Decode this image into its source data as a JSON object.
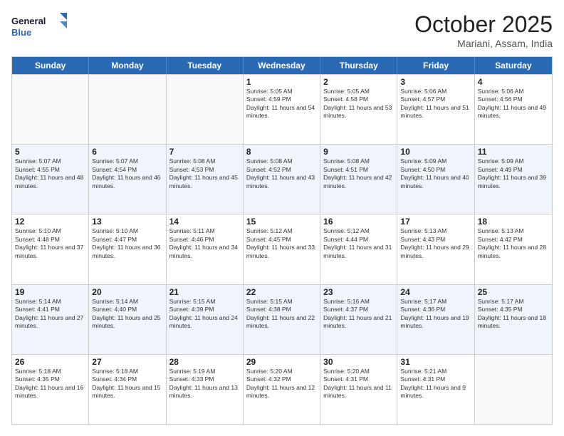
{
  "header": {
    "logo_line1": "General",
    "logo_line2": "Blue",
    "month": "October 2025",
    "location": "Mariani, Assam, India"
  },
  "weekdays": [
    "Sunday",
    "Monday",
    "Tuesday",
    "Wednesday",
    "Thursday",
    "Friday",
    "Saturday"
  ],
  "rows": [
    [
      {
        "day": "",
        "sunrise": "",
        "sunset": "",
        "daylight": "",
        "empty": true
      },
      {
        "day": "",
        "sunrise": "",
        "sunset": "",
        "daylight": "",
        "empty": true
      },
      {
        "day": "",
        "sunrise": "",
        "sunset": "",
        "daylight": "",
        "empty": true
      },
      {
        "day": "1",
        "sunrise": "Sunrise: 5:05 AM",
        "sunset": "Sunset: 4:59 PM",
        "daylight": "Daylight: 11 hours and 54 minutes."
      },
      {
        "day": "2",
        "sunrise": "Sunrise: 5:05 AM",
        "sunset": "Sunset: 4:58 PM",
        "daylight": "Daylight: 11 hours and 53 minutes."
      },
      {
        "day": "3",
        "sunrise": "Sunrise: 5:06 AM",
        "sunset": "Sunset: 4:57 PM",
        "daylight": "Daylight: 11 hours and 51 minutes."
      },
      {
        "day": "4",
        "sunrise": "Sunrise: 5:06 AM",
        "sunset": "Sunset: 4:56 PM",
        "daylight": "Daylight: 11 hours and 49 minutes."
      }
    ],
    [
      {
        "day": "5",
        "sunrise": "Sunrise: 5:07 AM",
        "sunset": "Sunset: 4:55 PM",
        "daylight": "Daylight: 11 hours and 48 minutes."
      },
      {
        "day": "6",
        "sunrise": "Sunrise: 5:07 AM",
        "sunset": "Sunset: 4:54 PM",
        "daylight": "Daylight: 11 hours and 46 minutes."
      },
      {
        "day": "7",
        "sunrise": "Sunrise: 5:08 AM",
        "sunset": "Sunset: 4:53 PM",
        "daylight": "Daylight: 11 hours and 45 minutes."
      },
      {
        "day": "8",
        "sunrise": "Sunrise: 5:08 AM",
        "sunset": "Sunset: 4:52 PM",
        "daylight": "Daylight: 11 hours and 43 minutes."
      },
      {
        "day": "9",
        "sunrise": "Sunrise: 5:08 AM",
        "sunset": "Sunset: 4:51 PM",
        "daylight": "Daylight: 11 hours and 42 minutes."
      },
      {
        "day": "10",
        "sunrise": "Sunrise: 5:09 AM",
        "sunset": "Sunset: 4:50 PM",
        "daylight": "Daylight: 11 hours and 40 minutes."
      },
      {
        "day": "11",
        "sunrise": "Sunrise: 5:09 AM",
        "sunset": "Sunset: 4:49 PM",
        "daylight": "Daylight: 11 hours and 39 minutes."
      }
    ],
    [
      {
        "day": "12",
        "sunrise": "Sunrise: 5:10 AM",
        "sunset": "Sunset: 4:48 PM",
        "daylight": "Daylight: 11 hours and 37 minutes."
      },
      {
        "day": "13",
        "sunrise": "Sunrise: 5:10 AM",
        "sunset": "Sunset: 4:47 PM",
        "daylight": "Daylight: 11 hours and 36 minutes."
      },
      {
        "day": "14",
        "sunrise": "Sunrise: 5:11 AM",
        "sunset": "Sunset: 4:46 PM",
        "daylight": "Daylight: 11 hours and 34 minutes."
      },
      {
        "day": "15",
        "sunrise": "Sunrise: 5:12 AM",
        "sunset": "Sunset: 4:45 PM",
        "daylight": "Daylight: 11 hours and 33 minutes."
      },
      {
        "day": "16",
        "sunrise": "Sunrise: 5:12 AM",
        "sunset": "Sunset: 4:44 PM",
        "daylight": "Daylight: 11 hours and 31 minutes."
      },
      {
        "day": "17",
        "sunrise": "Sunrise: 5:13 AM",
        "sunset": "Sunset: 4:43 PM",
        "daylight": "Daylight: 11 hours and 29 minutes."
      },
      {
        "day": "18",
        "sunrise": "Sunrise: 5:13 AM",
        "sunset": "Sunset: 4:42 PM",
        "daylight": "Daylight: 11 hours and 28 minutes."
      }
    ],
    [
      {
        "day": "19",
        "sunrise": "Sunrise: 5:14 AM",
        "sunset": "Sunset: 4:41 PM",
        "daylight": "Daylight: 11 hours and 27 minutes."
      },
      {
        "day": "20",
        "sunrise": "Sunrise: 5:14 AM",
        "sunset": "Sunset: 4:40 PM",
        "daylight": "Daylight: 11 hours and 25 minutes."
      },
      {
        "day": "21",
        "sunrise": "Sunrise: 5:15 AM",
        "sunset": "Sunset: 4:39 PM",
        "daylight": "Daylight: 11 hours and 24 minutes."
      },
      {
        "day": "22",
        "sunrise": "Sunrise: 5:15 AM",
        "sunset": "Sunset: 4:38 PM",
        "daylight": "Daylight: 11 hours and 22 minutes."
      },
      {
        "day": "23",
        "sunrise": "Sunrise: 5:16 AM",
        "sunset": "Sunset: 4:37 PM",
        "daylight": "Daylight: 11 hours and 21 minutes."
      },
      {
        "day": "24",
        "sunrise": "Sunrise: 5:17 AM",
        "sunset": "Sunset: 4:36 PM",
        "daylight": "Daylight: 11 hours and 19 minutes."
      },
      {
        "day": "25",
        "sunrise": "Sunrise: 5:17 AM",
        "sunset": "Sunset: 4:35 PM",
        "daylight": "Daylight: 11 hours and 18 minutes."
      }
    ],
    [
      {
        "day": "26",
        "sunrise": "Sunrise: 5:18 AM",
        "sunset": "Sunset: 4:35 PM",
        "daylight": "Daylight: 11 hours and 16 minutes."
      },
      {
        "day": "27",
        "sunrise": "Sunrise: 5:18 AM",
        "sunset": "Sunset: 4:34 PM",
        "daylight": "Daylight: 11 hours and 15 minutes."
      },
      {
        "day": "28",
        "sunrise": "Sunrise: 5:19 AM",
        "sunset": "Sunset: 4:33 PM",
        "daylight": "Daylight: 11 hours and 13 minutes."
      },
      {
        "day": "29",
        "sunrise": "Sunrise: 5:20 AM",
        "sunset": "Sunset: 4:32 PM",
        "daylight": "Daylight: 11 hours and 12 minutes."
      },
      {
        "day": "30",
        "sunrise": "Sunrise: 5:20 AM",
        "sunset": "Sunset: 4:31 PM",
        "daylight": "Daylight: 11 hours and 11 minutes."
      },
      {
        "day": "31",
        "sunrise": "Sunrise: 5:21 AM",
        "sunset": "Sunset: 4:31 PM",
        "daylight": "Daylight: 11 hours and 9 minutes."
      },
      {
        "day": "",
        "sunrise": "",
        "sunset": "",
        "daylight": "",
        "empty": true
      }
    ]
  ]
}
